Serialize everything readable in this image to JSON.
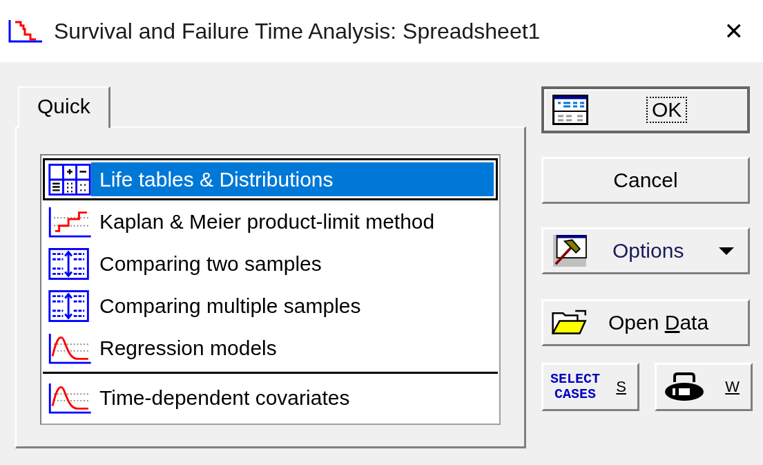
{
  "window": {
    "title": "Survival and Failure Time Analysis: Spreadsheet1",
    "close": "✕"
  },
  "tabs": [
    {
      "label": "Quick",
      "selected": true
    }
  ],
  "list": [
    {
      "label": "Life tables & Distributions",
      "kind": "table",
      "selected": true,
      "separator_before": false
    },
    {
      "label": "Kaplan & Meier product-limit method",
      "kind": "steps",
      "selected": false,
      "separator_before": false
    },
    {
      "label": "Comparing two samples",
      "kind": "compare",
      "selected": false,
      "separator_before": false
    },
    {
      "label": "Comparing multiple samples",
      "kind": "compare",
      "selected": false,
      "separator_before": false
    },
    {
      "label": "Regression models",
      "kind": "curve",
      "selected": false,
      "separator_before": false
    },
    {
      "label": "Time-dependent covariates",
      "kind": "curve",
      "selected": false,
      "separator_before": true
    }
  ],
  "buttons": {
    "ok": "OK",
    "cancel": "Cancel",
    "options": "Options",
    "open_data": {
      "before": "Open ",
      "key": "D",
      "after": "ata"
    },
    "select_cases": {
      "line_1": "SELECT",
      "line_2": "CASES",
      "key": "S"
    },
    "weight": {
      "key": "W"
    }
  }
}
